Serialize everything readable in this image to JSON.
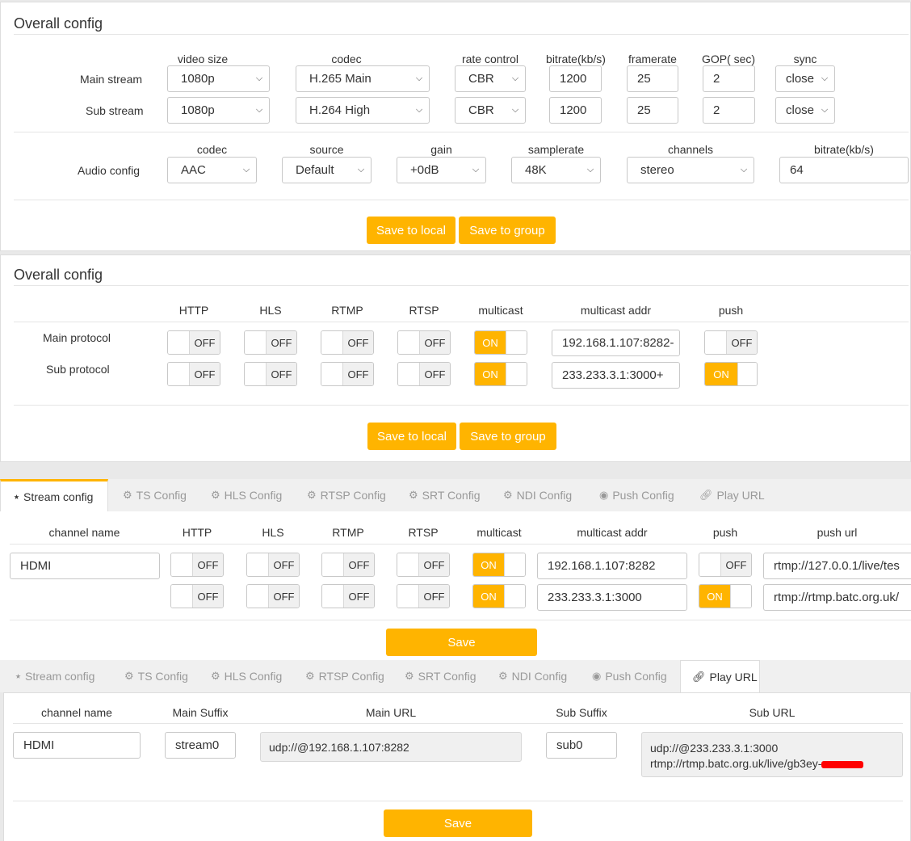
{
  "video_panel": {
    "title": "Overall config",
    "headers": [
      "video size",
      "codec",
      "rate control",
      "bitrate(kb/s)",
      "framerate",
      "GOP( sec)",
      "sync"
    ],
    "rows": [
      {
        "label": "Main stream",
        "size": "1080p",
        "codec": "H.265 Main",
        "rc": "CBR",
        "bitrate": "1200",
        "framerate": "25",
        "gop": "2",
        "sync": "close"
      },
      {
        "label": "Sub stream",
        "size": "1080p",
        "codec": "H.264 High",
        "rc": "CBR",
        "bitrate": "1200",
        "framerate": "25",
        "gop": "2",
        "sync": "close"
      }
    ],
    "audio": {
      "label": "Audio config",
      "headers": [
        "codec",
        "source",
        "gain",
        "samplerate",
        "channels",
        "bitrate(kb/s)"
      ],
      "codec": "AAC",
      "source": "Default",
      "gain": "+0dB",
      "samplerate": "48K",
      "channels": "stereo",
      "bitrate": "64"
    },
    "save_local": "Save to local",
    "save_group": "Save to group"
  },
  "protocol_panel": {
    "title": "Overall config",
    "headers": [
      "HTTP",
      "HLS",
      "RTMP",
      "RTSP",
      "multicast",
      "multicast addr",
      "push"
    ],
    "rows": [
      {
        "label": "Main protocol",
        "http": "OFF",
        "hls": "OFF",
        "rtmp": "OFF",
        "rtsp": "OFF",
        "multicast": "ON",
        "addr": "192.168.1.107:8282-",
        "push": "OFF"
      },
      {
        "label": "Sub protocol",
        "http": "OFF",
        "hls": "OFF",
        "rtmp": "OFF",
        "rtsp": "OFF",
        "multicast": "ON",
        "addr": "233.233.3.1:3000+",
        "push": "ON"
      }
    ],
    "save_local": "Save to local",
    "save_group": "Save to group"
  },
  "tabs": [
    "Stream config",
    "TS Config",
    "HLS Config",
    "RTSP Config",
    "SRT Config",
    "NDI Config",
    "Push Config",
    "Play URL"
  ],
  "stream_panel": {
    "headers": [
      "channel name",
      "HTTP",
      "HLS",
      "RTMP",
      "RTSP",
      "multicast",
      "multicast addr",
      "push",
      "push url"
    ],
    "channel_name": "HDMI",
    "rows": [
      {
        "http": "OFF",
        "hls": "OFF",
        "rtmp": "OFF",
        "rtsp": "OFF",
        "multicast": "ON",
        "addr": "192.168.1.107:8282",
        "push": "OFF",
        "push_url": "rtmp://127.0.0.1/live/tes"
      },
      {
        "http": "OFF",
        "hls": "OFF",
        "rtmp": "OFF",
        "rtsp": "OFF",
        "multicast": "ON",
        "addr": "233.233.3.1:3000",
        "push": "ON",
        "push_url": "rtmp://rtmp.batc.org.uk/"
      }
    ],
    "save": "Save"
  },
  "play_panel": {
    "headers": [
      "channel name",
      "Main Suffix",
      "Main URL",
      "Sub Suffix",
      "Sub URL"
    ],
    "channel_name": "HDMI",
    "main_suffix": "stream0",
    "main_url": "udp://@192.168.1.107:8282",
    "sub_suffix": "sub0",
    "sub_url_1": "udp://@233.233.3.1:3000",
    "sub_url_2": "rtmp://rtmp.batc.org.uk/live/gb3ey-",
    "save": "Save"
  },
  "colors": {
    "accent": "#ffb400",
    "redaction": "#ff0000"
  }
}
